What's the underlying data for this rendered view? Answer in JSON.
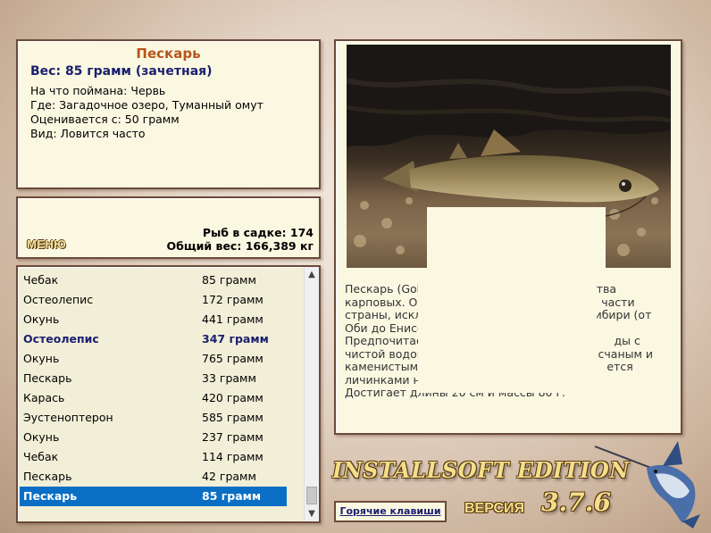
{
  "fish_info": {
    "name": "Пескарь",
    "weight_line": "Вес: 85 грамм (зачетная)",
    "caught_on": "На что поймана: Червь",
    "location": "Где: Загадочное озеро, Туманный омут",
    "valued_from": "Оценивается с: 50 грамм",
    "catch_rate": "Вид: Ловится часто"
  },
  "summary": {
    "menu_label": "МЕНЮ",
    "fish_in_keepnet": "Рыб в садке: 174",
    "total_weight": "Общий вес: 166,389 кг"
  },
  "catch_list": [
    {
      "name": "Чебак",
      "weight": "85 грамм"
    },
    {
      "name": "Остеолепис",
      "weight": "172 грамм"
    },
    {
      "name": "Окунь",
      "weight": "441 грамм"
    },
    {
      "name": "Остеолепис",
      "weight": "347 грамм",
      "bold": true
    },
    {
      "name": "Окунь",
      "weight": "765 грамм"
    },
    {
      "name": "Пескарь",
      "weight": "33 грамм"
    },
    {
      "name": "Карась",
      "weight": "420 грамм"
    },
    {
      "name": "Эустеноптерон",
      "weight": "585 грамм"
    },
    {
      "name": "Окунь",
      "weight": "237 грамм"
    },
    {
      "name": "Чебак",
      "weight": "114 грамм"
    },
    {
      "name": "Пескарь",
      "weight": "42 грамм"
    },
    {
      "name": "Пескарь",
      "weight": "85 грамм",
      "selected": true
    }
  ],
  "description": {
    "lines": [
      "Пескарь (Gobi                                              ства",
      "карповых. Обі                                                 части",
      "страны, исклю                                              ибири (от",
      "Оби до Енисе",
      "Предпочитает                                                    ды с",
      "чистой водой,                                                счаным и",
      "каменистым д                                                  ется",
      "личинками на",
      "Достигает длины 20 см и массы 80 г."
    ]
  },
  "footer": {
    "hotkeys_label": "Горячие клавиши",
    "edition": "INSTALLSOFT EDITION",
    "version_label": "ВЕРСИЯ",
    "version": "3.7.6"
  },
  "icons": {
    "scroll_up": "chevron-up-icon",
    "scroll_down": "chevron-down-icon",
    "logo": "marlin-icon"
  },
  "colors": {
    "panel_bg": "#fbf8e2",
    "title_orange": "#b5561a",
    "accent_navy": "#1b1f6e",
    "selection_blue": "#0a6fc4",
    "logo_gold": "#f4de8a"
  }
}
